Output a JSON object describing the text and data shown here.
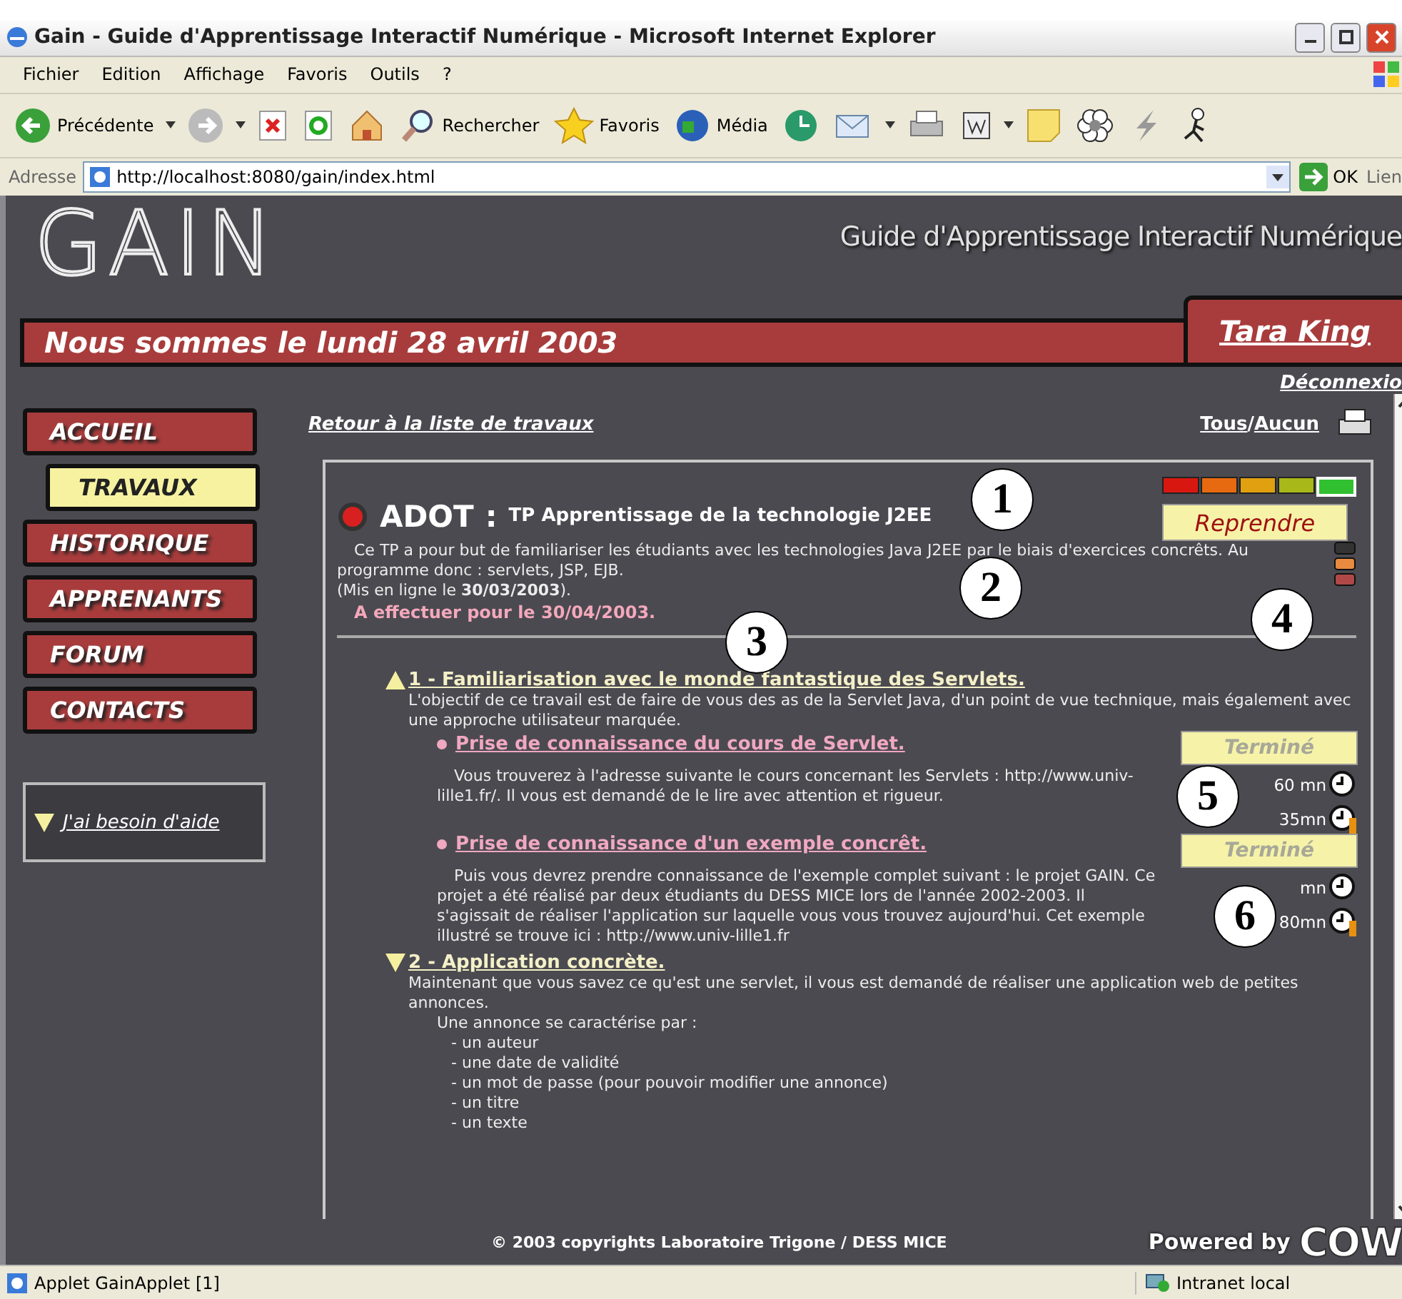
{
  "window": {
    "title": "Gain - Guide d'Apprentissage Interactif Numérique - Microsoft Internet Explorer"
  },
  "menu": [
    "Fichier",
    "Edition",
    "Affichage",
    "Favoris",
    "Outils",
    "?"
  ],
  "toolbar": [
    {
      "kind": "back",
      "label": "Précédente"
    },
    {
      "kind": "forward"
    },
    {
      "kind": "stop"
    },
    {
      "kind": "refresh"
    },
    {
      "kind": "home"
    },
    {
      "kind": "search",
      "label": "Rechercher"
    },
    {
      "kind": "favorites",
      "label": "Favoris"
    },
    {
      "kind": "media",
      "label": "Média"
    },
    {
      "kind": "history"
    },
    {
      "kind": "mail"
    },
    {
      "kind": "print"
    },
    {
      "kind": "edit"
    },
    {
      "kind": "note"
    },
    {
      "kind": "flower"
    },
    {
      "kind": "messenger"
    },
    {
      "kind": "person"
    }
  ],
  "address": {
    "label": "Adresse",
    "url": "http://localhost:8080/gain/index.html",
    "go": "OK",
    "links": "Lien"
  },
  "site": {
    "logo": "GAIN",
    "tagline": "Guide d'Apprentissage Interactif Numérique",
    "date": "Nous sommes le lundi 28 avril 2003",
    "user": "Tara King",
    "logout": "Déconnexio"
  },
  "nav": [
    {
      "label": "ACCUEIL",
      "selected": false
    },
    {
      "label": "TRAVAUX",
      "selected": true
    },
    {
      "label": "HISTORIQUE",
      "selected": false
    },
    {
      "label": "APPRENANTS",
      "selected": false
    },
    {
      "label": "FORUM",
      "selected": false
    },
    {
      "label": "CONTACTS",
      "selected": false
    }
  ],
  "help": "J'ai besoin d'aide",
  "back_link": "Retour à la liste de travaux",
  "filter": {
    "all": "Tous",
    "separator": "/",
    "none": "Aucun"
  },
  "task": {
    "code": "ADOT",
    "colon": ":",
    "title": "TP Apprentissage de la technologie J2EE",
    "difficulty": [
      {
        "color": "#d81810",
        "selected": false
      },
      {
        "color": "#e86a10",
        "selected": false
      },
      {
        "color": "#e0a010",
        "selected": false
      },
      {
        "color": "#a8b818",
        "selected": false
      },
      {
        "color": "#30c030",
        "selected": true
      }
    ],
    "action": "Reprendre",
    "description": "Ce TP a pour but de familiariser les étudiants avec les technologies Java J2EE par le biais d'exercices concrêts. Au programme donc : servlets, JSP, EJB.",
    "published": "(Mis en ligne le **30/03/2003**).",
    "due": "A effectuer pour le 30/04/2003.",
    "sections": [
      {
        "kind": "warning",
        "title": "1 - Familiarisation avec le monde fantastique des Servlets.",
        "lines": [
          "L'objectif de ce travail est de faire de vous des as de la Servlet Java, d'un point de vue technique, mais également avec une approche utilisateur marquée."
        ],
        "steps": [
          {
            "title": "Prise de connaissance du cours de Servlet.",
            "action": "Terminé",
            "disabled": true,
            "text": "Vous trouverez à l'adresse suivante le cours concernant les Servlets : http://www.univ-lille1.fr/. Il vous est demandé de le lire avec attention et rigueur.",
            "planned": "60 mn",
            "spent": "35mn"
          },
          {
            "title": "Prise de connaissance d'un exemple concrêt.",
            "action": "Terminé",
            "disabled": true,
            "text": "Puis vous devrez prendre connaissance de l'exemple complet suivant : le projet GAIN. Ce projet a été réalisé par deux étudiants du DESS MICE lors de l'année 2002-2003. Il s'agissait de réaliser l'application sur laquelle vous vous trouvez aujourd'hui. Cet exemple illustré se trouve ici : http://www.univ-lille1.fr",
            "planned": "mn",
            "spent": "80mn"
          }
        ]
      },
      {
        "kind": "open",
        "title": "2 - Application concrète.",
        "lines": [
          "Maintenant que vous savez ce qu'est une servlet, il vous est demandé de réaliser une application web de petites annonces.",
          "Une annonce se caractérise par :",
          "- un auteur",
          "- une date de validité",
          "- un mot de passe (pour pouvoir modifier une annonce)",
          "- un titre",
          "- un texte"
        ]
      }
    ]
  },
  "callouts": [
    "1",
    "2",
    "3",
    "4",
    "5",
    "6"
  ],
  "footer": {
    "copyright": "© 2003 copyrights Laboratoire Trigone / DESS MICE",
    "powered": "Powered by",
    "logo": "COW"
  },
  "status_bar": {
    "text": "Applet GainApplet [1]",
    "zone": "Intranet local"
  }
}
